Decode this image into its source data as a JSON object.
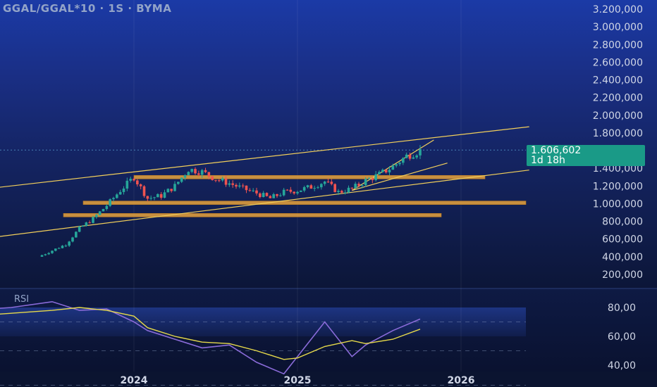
{
  "header": {
    "symbol_title": "GGAL/GGAL*10 · 1S · BYMA"
  },
  "price_tag": {
    "value": "1.606,602",
    "countdown": "1d 18h"
  },
  "rsi": {
    "label": "RSI"
  },
  "colors": {
    "background_top": "#0a1226",
    "background_mid": "#1d3ea8",
    "up_candle": "#26a69a",
    "down_candle": "#ef5350",
    "trendline": "#f2cf5b",
    "support_zone": "#e8a33c",
    "rsi_line": "#8a6bd9",
    "rsi_ma": "#e6d94a",
    "price_tag": "#1a9a87",
    "axis_text": "#d0d6e6"
  },
  "chart_data": [
    {
      "type": "candlestick",
      "title": "GGAL/GGAL*10 · 1S · BYMA",
      "x_tick_labels": [
        "2024",
        "2025",
        "2026"
      ],
      "y_tick_labels": [
        "3.200,000",
        "3.000,000",
        "2.800,000",
        "2.600,000",
        "2.400,000",
        "2.200,000",
        "2.000,000",
        "1.800,000",
        "1.400,000",
        "1.200,000",
        "1.000,000",
        "800,000",
        "600,000",
        "400,000",
        "200,000"
      ],
      "y_ticks": [
        3200,
        3000,
        2800,
        2600,
        2400,
        2200,
        2000,
        1800,
        1400,
        1200,
        1000,
        800,
        600,
        400,
        200
      ],
      "ylim": [
        150,
        3250
      ],
      "last_price": 1606.602,
      "series": [
        {
          "x": [
            "2023-06",
            "2023-07",
            "2023-08",
            "2023-09",
            "2023-10",
            "2023-11",
            "2023-12",
            "2024-01",
            "2024-02",
            "2024-03",
            "2024-04",
            "2024-05",
            "2024-06",
            "2024-07",
            "2024-08",
            "2024-09",
            "2024-10",
            "2024-11",
            "2024-12",
            "2025-01",
            "2025-02",
            "2025-03",
            "2025-04",
            "2025-05",
            "2025-06",
            "2025-07",
            "2025-08",
            "2025-09",
            "2025-10"
          ],
          "values": [
            400,
            470,
            540,
            720,
            830,
            980,
            1150,
            1300,
            1060,
            1090,
            1200,
            1390,
            1360,
            1280,
            1230,
            1170,
            1120,
            1060,
            1130,
            1150,
            1190,
            1250,
            1130,
            1170,
            1260,
            1330,
            1420,
            1540,
            1600
          ]
        }
      ],
      "annotations": {
        "horizontal_zones": [
          1300,
          1010,
          870
        ],
        "trendlines": [
          {
            "from": [
              "2022-10",
              1095
            ],
            "to": [
              "2026-06",
              1870
            ]
          },
          {
            "from": [
              "2022-10",
              530
            ],
            "to": [
              "2026-06",
              1380
            ]
          },
          {
            "from": [
              "2025-05",
              1150
            ],
            "to": [
              "2025-11",
              1720
            ]
          },
          {
            "from": [
              "2025-05",
              1150
            ],
            "to": [
              "2025-12",
              1460
            ]
          }
        ]
      }
    },
    {
      "type": "line",
      "title": "RSI",
      "y_tick_labels": [
        "80,00",
        "60,00",
        "40,00"
      ],
      "y_ticks": [
        80,
        60,
        40
      ],
      "ylim": [
        30,
        85
      ],
      "levels": [
        70,
        50
      ],
      "series": [
        {
          "x": [
            "2022-10",
            "2023-01",
            "2023-04",
            "2023-07",
            "2023-09",
            "2023-11",
            "2024-01",
            "2024-02",
            "2024-04",
            "2024-06",
            "2024-08",
            "2024-10",
            "2024-12",
            "2025-01",
            "2025-03",
            "2025-05",
            "2025-06",
            "2025-08",
            "2025-10"
          ],
          "values": [
            74,
            78,
            80,
            84,
            78,
            79,
            70,
            64,
            58,
            52,
            54,
            42,
            34,
            46,
            70,
            46,
            54,
            64,
            72
          ]
        },
        {
          "x": [
            "2022-10",
            "2023-01",
            "2023-04",
            "2023-07",
            "2023-09",
            "2023-11",
            "2024-01",
            "2024-02",
            "2024-04",
            "2024-06",
            "2024-08",
            "2024-10",
            "2024-12",
            "2025-01",
            "2025-03",
            "2025-05",
            "2025-06",
            "2025-08",
            "2025-10"
          ],
          "values": [
            72,
            74,
            76,
            78,
            80,
            78,
            74,
            66,
            60,
            56,
            55,
            50,
            44,
            45,
            53,
            57,
            55,
            58,
            65
          ]
        }
      ]
    }
  ]
}
